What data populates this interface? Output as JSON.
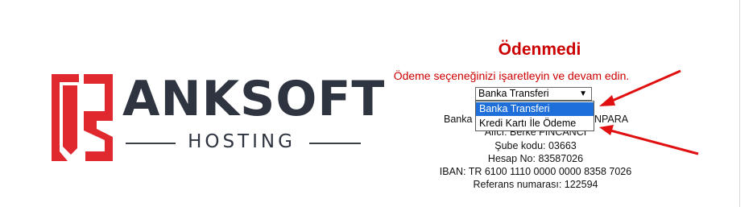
{
  "brand": {
    "name": "ANKSOFT",
    "tagline": "HOSTING",
    "mark_color": "#e0282f",
    "text_color": "#2e3440"
  },
  "payment": {
    "status_title": "Ödenmedi",
    "instruction": "Ödeme seçeneğinizi işaretleyin ve devam edin.",
    "method_select": {
      "selected_value": "Banka Transferi",
      "options": [
        "Banka Transferi",
        "Kredi Kartı İle Ödeme"
      ],
      "highlighted_option": "Banka Transferi"
    },
    "bank_info": {
      "bank_label": "Banka",
      "bank_name_tail": "NPARA",
      "recipient": "Alıcı: Berke FINCANCI",
      "branch_code": "Şube kodu: 03663",
      "account_no": "Hesap No: 83587026",
      "iban": "IBAN: TR 6100 1110 0000 0000 8358 7026",
      "reference": "Referans numarası: 122594"
    }
  },
  "annotations": {
    "arrow_color": "#e01010",
    "arrow_count": 2
  }
}
